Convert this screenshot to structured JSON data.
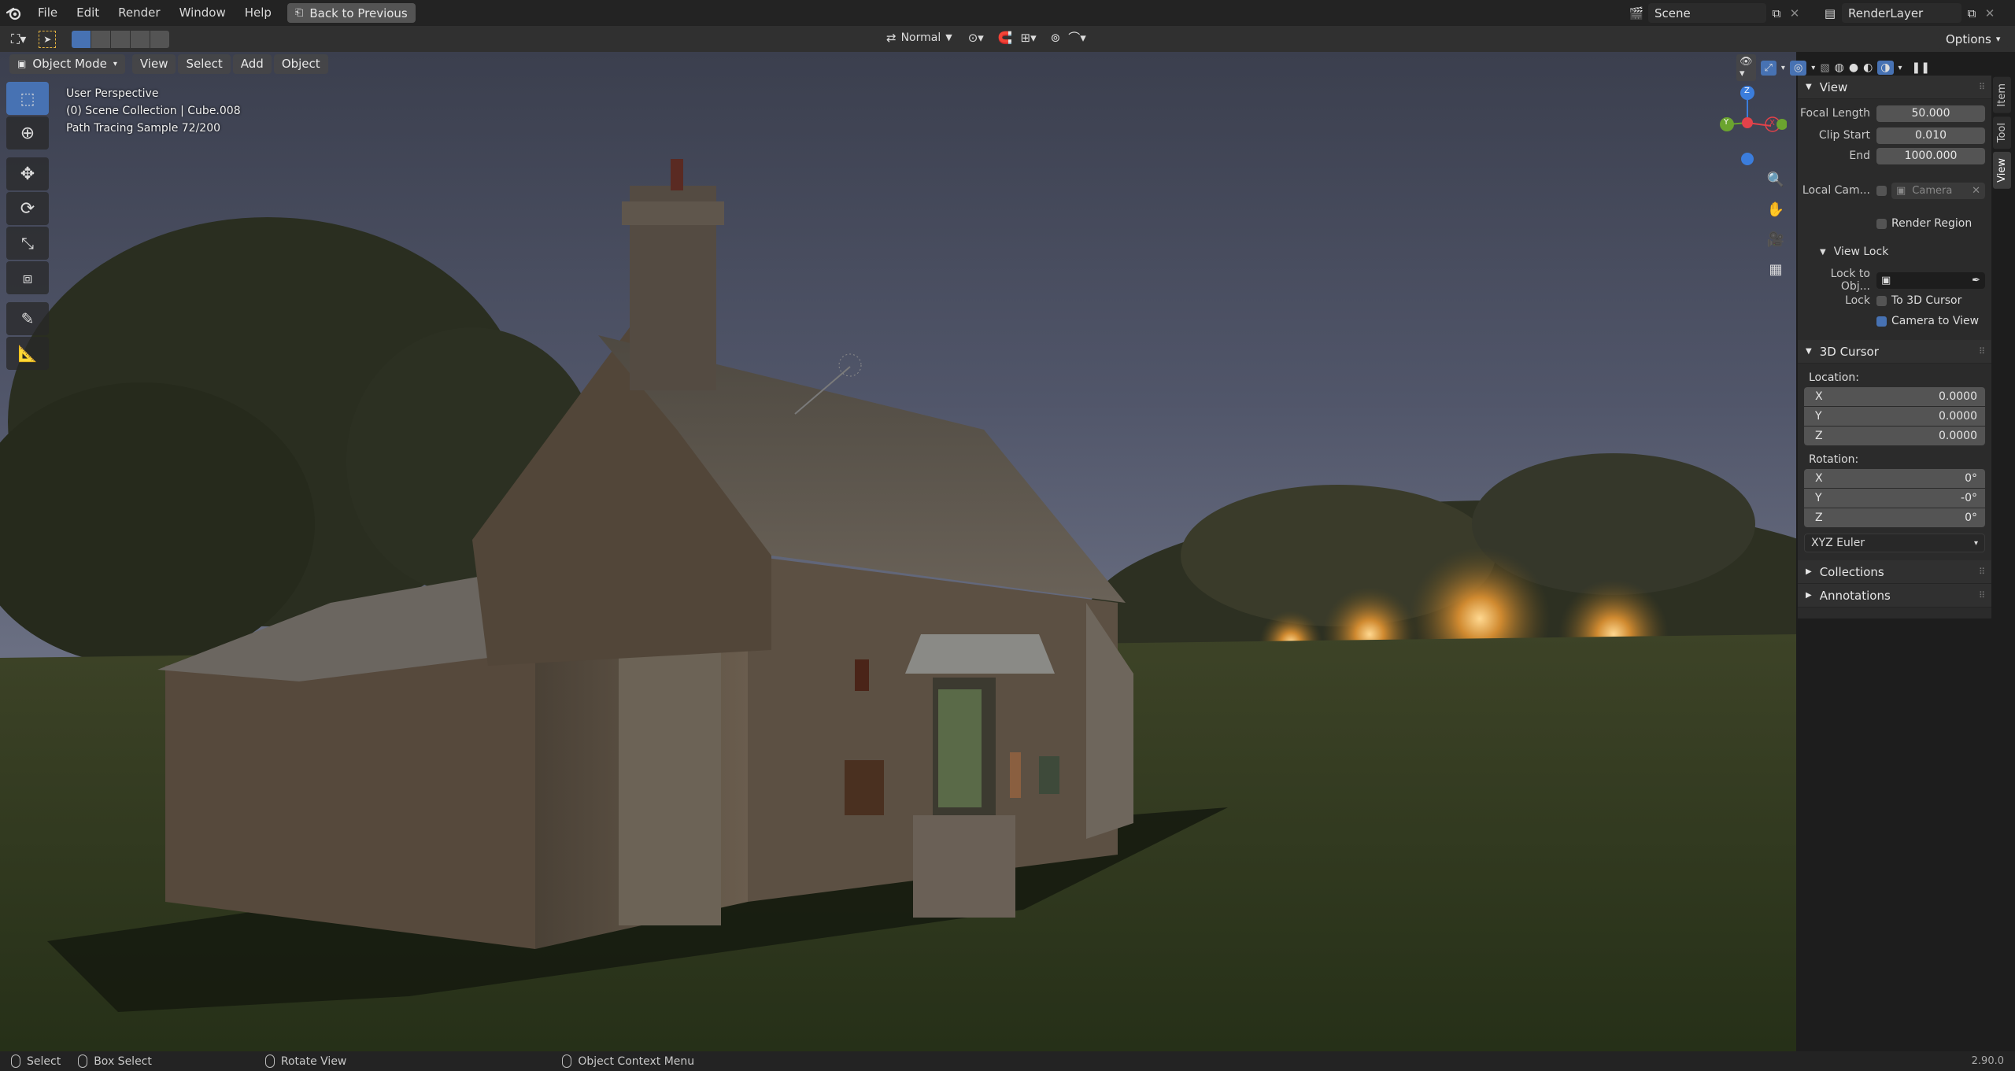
{
  "menubar": {
    "items": [
      "File",
      "Edit",
      "Render",
      "Window",
      "Help"
    ],
    "back_button": "Back to Previous",
    "scene_name": "Scene",
    "render_layer": "RenderLayer"
  },
  "toolheader": {
    "orientation": "Normal",
    "options_label": "Options"
  },
  "viewport_header": {
    "mode": "Object Mode",
    "menus": [
      "View",
      "Select",
      "Add",
      "Object"
    ]
  },
  "viewport_overlay": {
    "line1": "User Perspective",
    "line2": "(0) Scene Collection | Cube.008",
    "line3": "Path Tracing Sample 72/200"
  },
  "gizmo": {
    "x": "X",
    "y": "Y",
    "z": "Z"
  },
  "npanel": {
    "view_header": "View",
    "focal_length_label": "Focal Length",
    "focal_length": "50.000",
    "clip_start_label": "Clip Start",
    "clip_start": "0.010",
    "clip_end_label": "End",
    "clip_end": "1000.000",
    "local_camera_label": "Local Cam...",
    "local_camera_value": "Camera",
    "render_region_label": "Render Region",
    "view_lock_header": "View Lock",
    "lock_to_object_label": "Lock to Obj...",
    "lock_label": "Lock",
    "to_3d_cursor_label": "To 3D Cursor",
    "camera_to_view_label": "Camera to View",
    "cursor_header": "3D Cursor",
    "location_label": "Location:",
    "loc_x_label": "X",
    "loc_x": "0.0000",
    "loc_y_label": "Y",
    "loc_y": "0.0000",
    "loc_z_label": "Z",
    "loc_z": "0.0000",
    "rotation_label": "Rotation:",
    "rot_x_label": "X",
    "rot_x": "0°",
    "rot_y_label": "Y",
    "rot_y": "-0°",
    "rot_z_label": "Z",
    "rot_z": "0°",
    "rotation_mode": "XYZ Euler",
    "collections_header": "Collections",
    "annotations_header": "Annotations"
  },
  "side_tabs": [
    "Item",
    "Tool",
    "View"
  ],
  "statusbar": {
    "select": "Select",
    "box_select": "Box Select",
    "rotate_view": "Rotate View",
    "context_menu": "Object Context Menu",
    "version": "2.90.0"
  },
  "colors": {
    "accent": "#4772b3",
    "panel_bg": "#2b2b2b",
    "axis_x": "#e3424a",
    "axis_y": "#6ba42f",
    "axis_z": "#3b7ddc"
  }
}
